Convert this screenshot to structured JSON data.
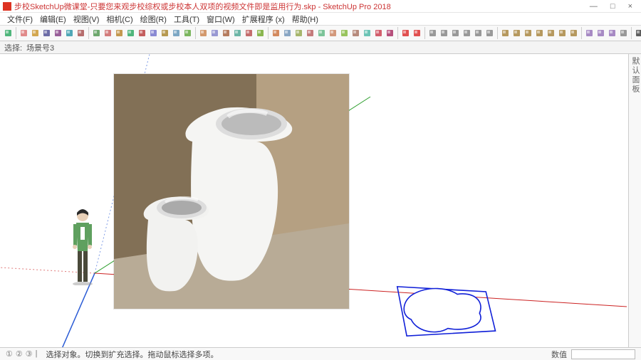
{
  "window": {
    "title": "步校SketchUp微课堂-只要您来观步校综权或步校本人双项的视频文件即是监用行为.skp - SketchUp Pro 2018",
    "minimize": "—",
    "maximize": "□",
    "close": "×"
  },
  "menu": {
    "items": [
      "文件(F)",
      "编辑(E)",
      "视图(V)",
      "相机(C)",
      "绘图(R)",
      "工具(T)",
      "窗口(W)",
      "扩展程序 (x)",
      "帮助(H)"
    ]
  },
  "toolbar": {
    "icons": [
      "select-icon",
      "eraser-icon",
      "pencil-icon",
      "line-icon",
      "arc-icon",
      "rect-icon",
      "circle-icon",
      "polygon-icon",
      "pushpull-icon",
      "move-icon",
      "rotate-icon",
      "scale-icon",
      "offset-icon",
      "tape-icon",
      "text-icon",
      "paint-icon",
      "orbit-icon",
      "pan-icon",
      "zoom-icon",
      "zoomext-icon",
      "undo-icon",
      "redo-icon",
      "section-icon",
      "layers-icon",
      "outliner-icon",
      "camera-icon",
      "walk-icon",
      "look-icon",
      "position-icon",
      "sandbox1-icon",
      "sandbox2-icon",
      "sandbox3-icon",
      "photo-icon",
      "record-icon",
      "stop-icon",
      "views1-icon",
      "views2-icon",
      "views3-icon",
      "views4-icon",
      "views5-icon",
      "views6-icon",
      "style1-icon",
      "style2-icon",
      "style3-icon",
      "style4-icon",
      "style5-icon",
      "style6-icon",
      "style7-icon",
      "shadow-icon",
      "fog-icon",
      "xray-icon",
      "layer-icon",
      "list-icon"
    ],
    "colors": [
      "#3a6",
      "#d77",
      "#c93",
      "#559",
      "#848",
      "#39a",
      "#a55",
      "#595",
      "#c66",
      "#b83",
      "#3a6",
      "#b44",
      "#77c",
      "#a83",
      "#69b",
      "#6a4",
      "#c85",
      "#88c",
      "#a64",
      "#5a9",
      "#b55",
      "#7a3",
      "#c74",
      "#79b",
      "#9a5",
      "#b66",
      "#6b8",
      "#c86",
      "#8b4",
      "#a76",
      "#5ba",
      "#c45",
      "#a36",
      "#d33",
      "#d33",
      "#888",
      "#888",
      "#888",
      "#888",
      "#888",
      "#888",
      "#a84",
      "#a84",
      "#a84",
      "#a84",
      "#a84",
      "#a84",
      "#a84",
      "#97b",
      "#97b",
      "#97b",
      "#888",
      "#444"
    ]
  },
  "selection_tabs": {
    "label1": "选择:",
    "label2": "场景号3"
  },
  "right_panel": {
    "label": "默认面板"
  },
  "status": {
    "hint": "选择对象。切换到扩充选择。拖动鼠标选择多项。",
    "value_label": "数值",
    "circles": [
      "①",
      "②",
      "③"
    ],
    "divider": "|"
  }
}
